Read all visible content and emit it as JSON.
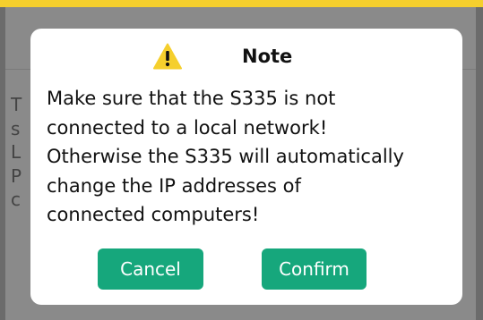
{
  "colors": {
    "accent_bar": "#f5cf2d",
    "button_bg": "#16a77c",
    "button_text": "#ffffff",
    "warning_icon": "#f5cf2d"
  },
  "background": {
    "partial_lines": [
      "T",
      "s",
      "L",
      "P",
      "c"
    ]
  },
  "dialog": {
    "icon": "warning-triangle-icon",
    "title": "Note",
    "message": "Make sure that the S335 is not\nconnected to a local network!\nOtherwise the S335 will automatically\nchange the IP addresses of\nconnected computers!",
    "cancel_label": "Cancel",
    "confirm_label": "Confirm"
  }
}
